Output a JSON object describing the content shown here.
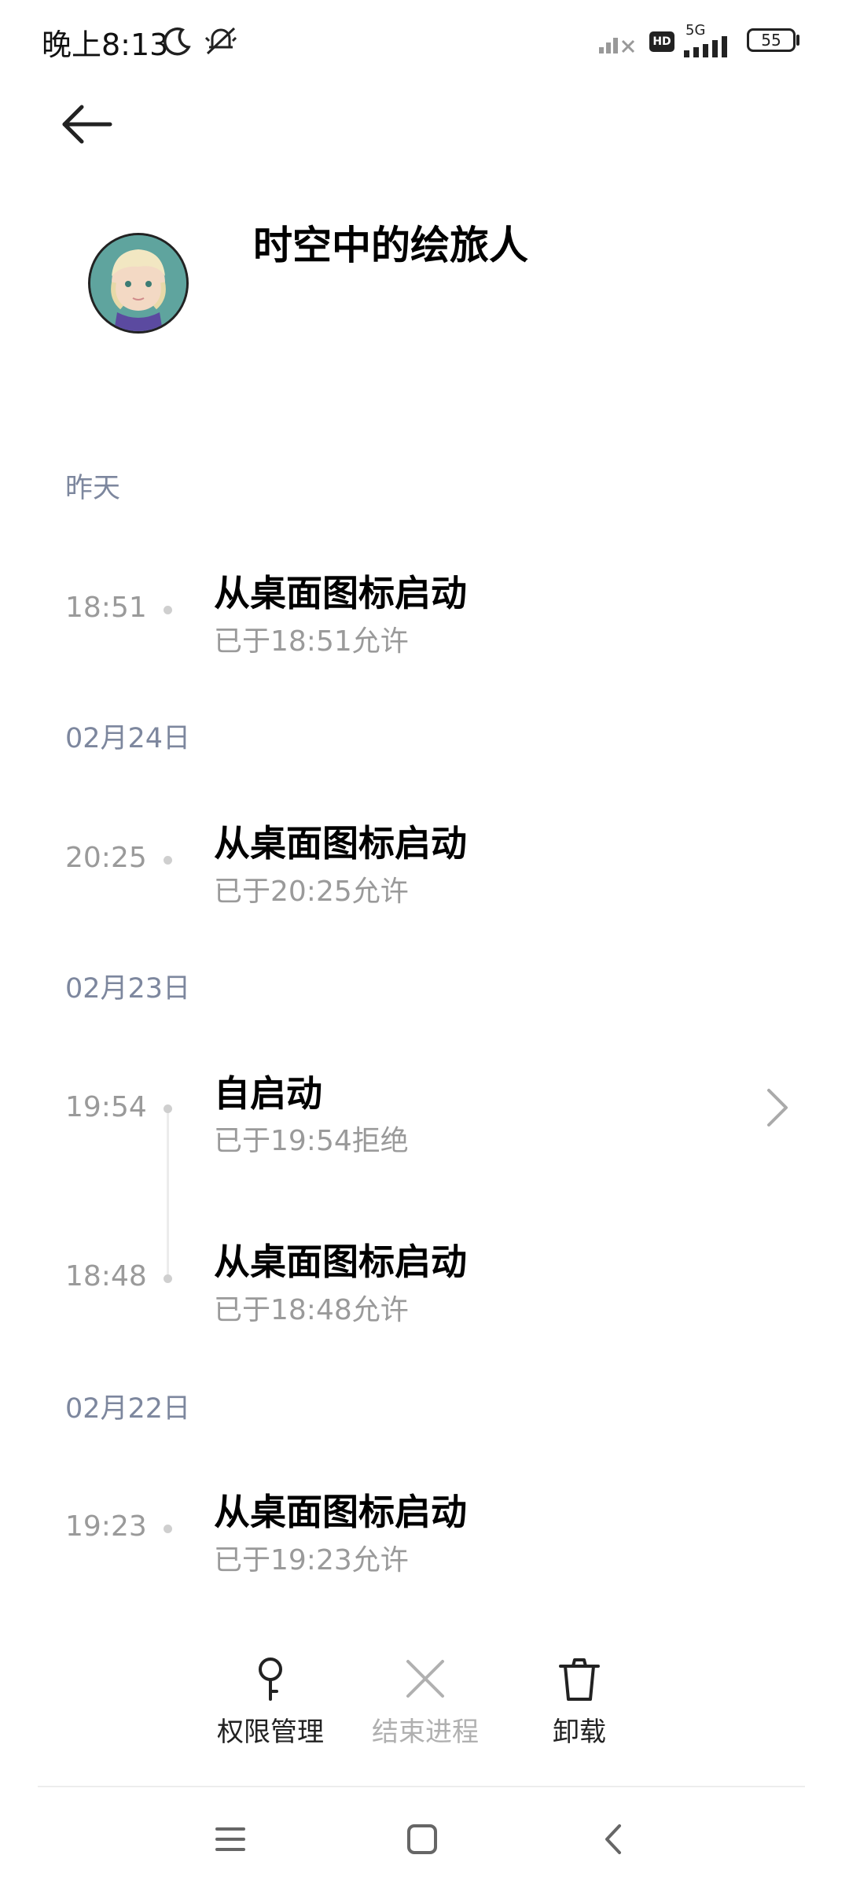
{
  "status_bar": {
    "time": "晚上8:13",
    "network": "5G",
    "hd": "HD",
    "battery": "55"
  },
  "header": {
    "app_name": "时空中的绘旅人"
  },
  "sections": [
    {
      "date": "昨天",
      "entries": [
        {
          "time": "18:51",
          "title": "从桌面图标启动",
          "sub": "已于18:51允许"
        }
      ]
    },
    {
      "date": "02月24日",
      "entries": [
        {
          "time": "20:25",
          "title": "从桌面图标启动",
          "sub": "已于20:25允许"
        }
      ]
    },
    {
      "date": "02月23日",
      "entries": [
        {
          "time": "19:54",
          "title": "自启动",
          "sub": "已于19:54拒绝"
        },
        {
          "time": "18:48",
          "title": "从桌面图标启动",
          "sub": "已于18:48允许"
        }
      ]
    },
    {
      "date": "02月22日",
      "entries": [
        {
          "time": "19:23",
          "title": "从桌面图标启动",
          "sub": "已于19:23允许"
        }
      ]
    }
  ],
  "actions": {
    "permissions": "权限管理",
    "end_process": "结束进程",
    "uninstall": "卸载"
  },
  "colors": {
    "date_header": "#7d879e",
    "muted_text": "#9a9a9a",
    "disabled": "#b0b0b0",
    "app_icon_bg": "#5fa49e"
  }
}
